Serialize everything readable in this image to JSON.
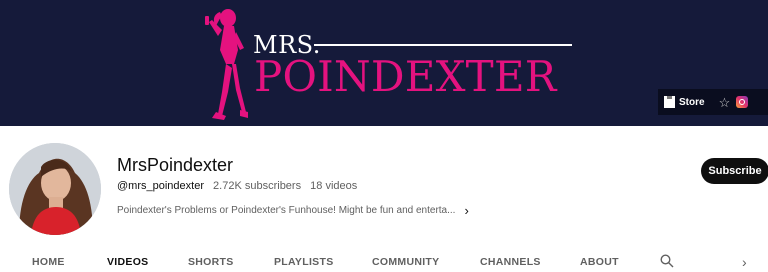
{
  "banner": {
    "brand_prefix": "MRS.",
    "brand_name": "POINDEXTER",
    "links": {
      "store_label": "Store",
      "star_icon": "star-icon",
      "instagram_icon": "instagram-icon"
    }
  },
  "channel": {
    "name": "MrsPoindexter",
    "handle": "@mrs_poindexter",
    "subscribers": "2.72K subscribers",
    "videos": "18 videos",
    "description": "Poindexter's Problems or Poindexter's Funhouse! Might be fun and enterta..."
  },
  "subscribe_label": "Subscribe",
  "tabs": [
    {
      "label": "HOME",
      "active": false
    },
    {
      "label": "VIDEOS",
      "active": true
    },
    {
      "label": "SHORTS",
      "active": false
    },
    {
      "label": "PLAYLISTS",
      "active": false
    },
    {
      "label": "COMMUNITY",
      "active": false
    },
    {
      "label": "CHANNELS",
      "active": false
    },
    {
      "label": "ABOUT",
      "active": false
    }
  ],
  "colors": {
    "banner_bg": "#151a3a",
    "brand_pink": "#e4127f",
    "subscribe_bg": "#0f0f0f"
  }
}
